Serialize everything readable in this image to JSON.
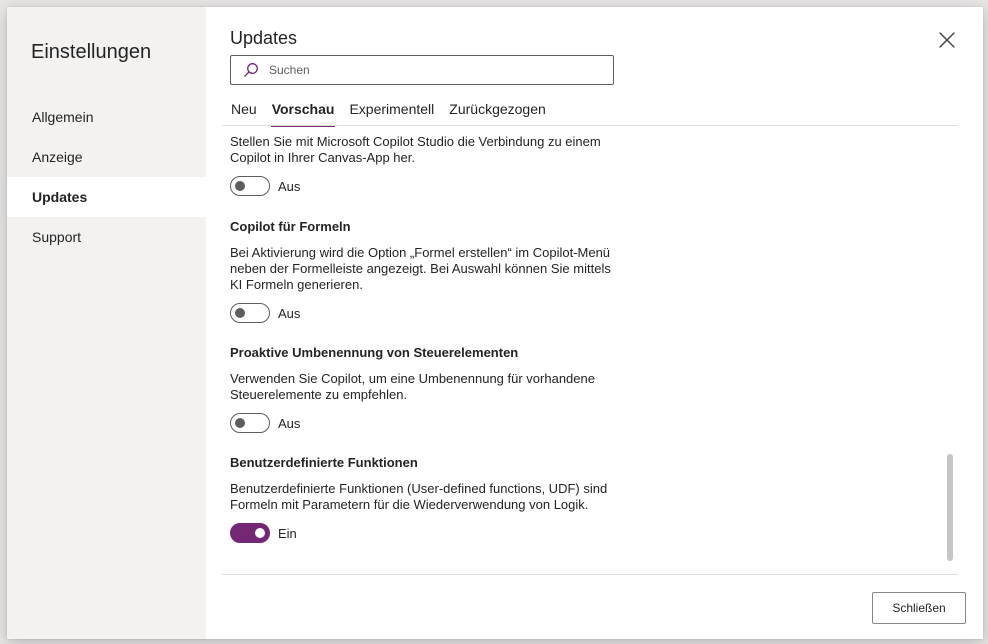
{
  "sidebar": {
    "title": "Einstellungen",
    "items": [
      {
        "label": "Allgemein",
        "active": false
      },
      {
        "label": "Anzeige",
        "active": false
      },
      {
        "label": "Updates",
        "active": true
      },
      {
        "label": "Support",
        "active": false
      }
    ]
  },
  "header": {
    "title": "Updates",
    "close_icon": "close-icon"
  },
  "search": {
    "placeholder": "Suchen",
    "value": "",
    "icon": "search-icon"
  },
  "tabs": [
    {
      "label": "Neu",
      "active": false
    },
    {
      "label": "Vorschau",
      "active": true
    },
    {
      "label": "Experimentell",
      "active": false
    },
    {
      "label": "Zurückgezogen",
      "active": false
    }
  ],
  "settings": [
    {
      "title": "",
      "description": "Stellen Sie mit Microsoft Copilot Studio die Verbindung zu einem Copilot in Ihrer Canvas-App her.",
      "state_label": "Aus",
      "enabled": false
    },
    {
      "title": "Copilot für Formeln",
      "description": "Bei Aktivierung wird die Option „Formel erstellen“ im Copilot-Menü neben der Formelleiste angezeigt. Bei Auswahl können Sie mittels KI Formeln generieren.",
      "state_label": "Aus",
      "enabled": false
    },
    {
      "title": "Proaktive Umbenennung von Steuerelementen",
      "description": "Verwenden Sie Copilot, um eine Umbenennung für vorhandene Steuerelemente zu empfehlen.",
      "state_label": "Aus",
      "enabled": false
    },
    {
      "title": "Benutzerdefinierte Funktionen",
      "description": "Benutzerdefinierte Funktionen (User-defined functions, UDF) sind Formeln mit Parametern für die Wiederverwendung von Logik.",
      "state_label": "Ein",
      "enabled": true
    }
  ],
  "footer": {
    "close_label": "Schließen"
  },
  "colors": {
    "accent": "#742774",
    "sidebar_bg": "#f3f2f1",
    "text": "#242424",
    "toggle_off": "#605e5c"
  }
}
